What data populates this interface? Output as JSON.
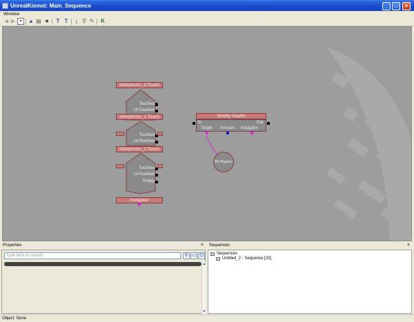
{
  "window": {
    "title": "UnrealKismet: Main_Sequence"
  },
  "menu": {
    "items": [
      "Window"
    ]
  },
  "toolbar": {
    "icons": [
      "back-arrow-icon",
      "forward-arrow-icon",
      "history-dropdown-icon",
      "parent-sequence-icon",
      "rename-sequence-icon",
      "screenshot-icon",
      "toggle-text-icon",
      "toggle-text-all-icon",
      "search-icon",
      "zoom-icon",
      "link-icon",
      "kismet-k-icon"
    ]
  },
  "canvas": {
    "nodes": [
      {
        "title": "InterpActor_0 Touch",
        "outputs": [
          "Touched",
          "UnTouched"
        ]
      },
      {
        "title": "InterpActor_1 Touch",
        "outputs": [
          "Touched",
          "UnTouched"
        ]
      },
      {
        "title": "InterpActor_2 Touch",
        "outputs": [
          "Touched",
          "UnTouched",
          "Empty"
        ]
      }
    ],
    "instigator_label": "Instigator",
    "action": {
      "title": "Modify Health",
      "in_label": "In",
      "out_label": "Out",
      "vars": [
        "Target",
        "Amount",
        "Instigator"
      ]
    },
    "variable": {
      "label": "All Players"
    }
  },
  "properties": {
    "title": "Properties",
    "search_placeholder": "Type here to search"
  },
  "sequences": {
    "title": "Sequences",
    "root": "Sequences",
    "child": "Untitled_2 - Sequence [23]"
  },
  "status": {
    "text": "Object: None"
  },
  "colors": {
    "titlebar": "#1849c8",
    "canvas": "#9d9d9d",
    "node_title": "#c77a7a",
    "link_magenta": "#e020e0",
    "pin_blue": "#1a1ad0"
  }
}
